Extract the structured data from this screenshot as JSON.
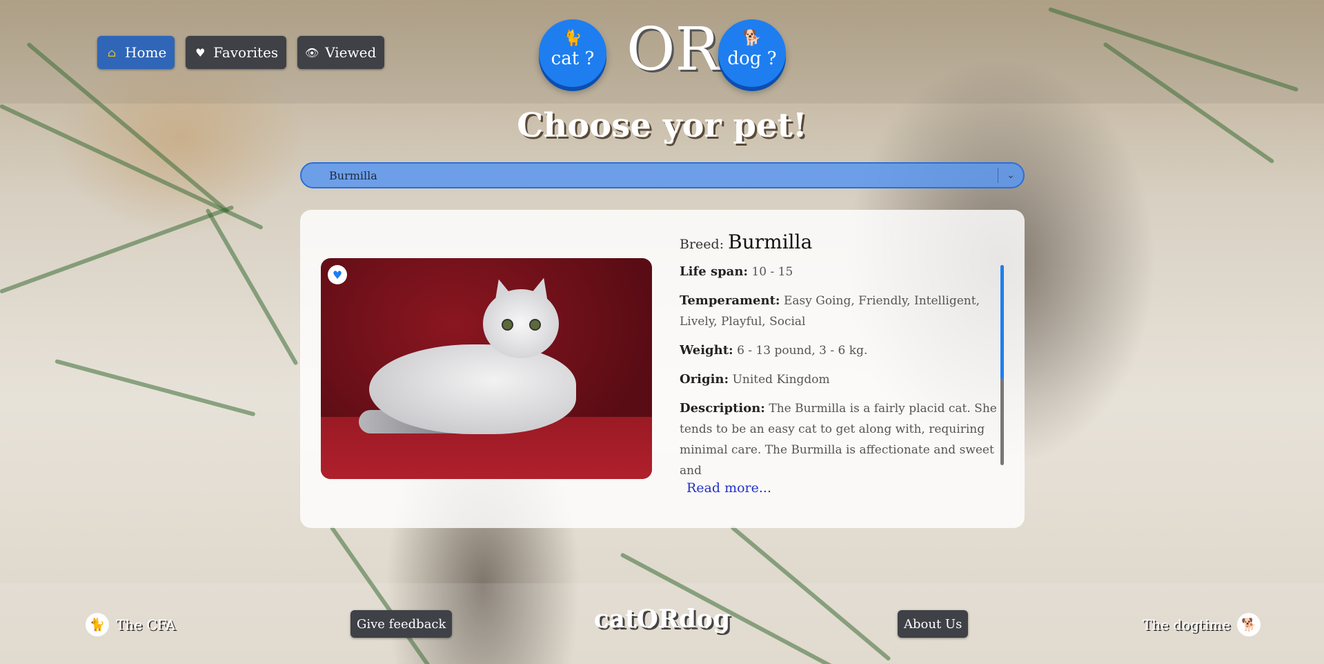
{
  "nav": {
    "items": [
      {
        "label": "Home",
        "icon": "home-icon",
        "active": true
      },
      {
        "label": "Favorites",
        "icon": "heart-icon",
        "active": false
      },
      {
        "label": "Viewed",
        "icon": "eye-icon",
        "active": false
      }
    ]
  },
  "logo": {
    "cat_label": "cat ?",
    "or_text": "OR",
    "dog_label": "dog ?"
  },
  "heading": "Choose yor pet!",
  "breed_select": {
    "selected": "Burmilla"
  },
  "card": {
    "breed_label": "Breed:",
    "breed_name": "Burmilla",
    "fields": [
      {
        "label": "Life span:",
        "value": "10 - 15"
      },
      {
        "label": "Temperament:",
        "value": "Easy Going, Friendly, Intelligent, Lively, Playful, Social"
      },
      {
        "label": "Weight:",
        "value": "6 - 13 pound, 3 - 6 kg."
      },
      {
        "label": "Origin:",
        "value": "United Kingdom"
      },
      {
        "label": "Description:",
        "value": "The Burmilla is a fairly placid cat. She tends to be an easy cat to get along with, requiring minimal care. The Burmilla is affectionate and sweet and"
      }
    ],
    "read_more": "Read more..."
  },
  "footer": {
    "left_link": "The CFA",
    "feedback_button": "Give feedback",
    "brand": "catORdog",
    "about_button": "About Us",
    "right_link": "The dogtime"
  },
  "colors": {
    "accent": "#1e7ef0",
    "button_dark": "#3f4147",
    "link": "#2331c8"
  }
}
